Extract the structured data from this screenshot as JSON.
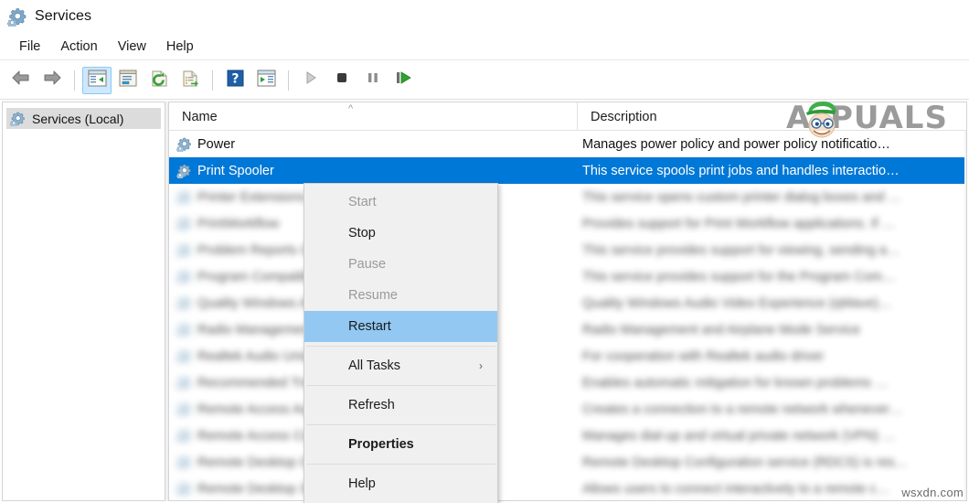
{
  "window": {
    "title": "Services",
    "icon": "services-gear-icon"
  },
  "menubar": {
    "items": [
      {
        "label": "File",
        "name": "menu-file"
      },
      {
        "label": "Action",
        "name": "menu-action"
      },
      {
        "label": "View",
        "name": "menu-view"
      },
      {
        "label": "Help",
        "name": "menu-help"
      }
    ]
  },
  "toolbar": {
    "buttons": [
      {
        "icon": "back-arrow-icon",
        "name": "toolbar-back",
        "active": false
      },
      {
        "icon": "forward-arrow-icon",
        "name": "toolbar-forward",
        "active": false
      },
      {
        "icon": "show-hide-console-tree-icon",
        "name": "toolbar-show-console-tree",
        "active": true
      },
      {
        "icon": "properties-window-icon",
        "name": "toolbar-properties",
        "active": false
      },
      {
        "icon": "refresh-icon",
        "name": "toolbar-refresh",
        "active": false
      },
      {
        "icon": "export-list-icon",
        "name": "toolbar-export-list",
        "active": false
      },
      {
        "icon": "help-icon",
        "name": "toolbar-help",
        "active": false
      },
      {
        "icon": "show-action-pane-icon",
        "name": "toolbar-show-action-pane",
        "active": false
      },
      {
        "icon": "start-service-icon",
        "name": "toolbar-start-service",
        "active": false
      },
      {
        "icon": "stop-service-icon",
        "name": "toolbar-stop-service",
        "active": false
      },
      {
        "icon": "pause-service-icon",
        "name": "toolbar-pause-service",
        "active": false
      },
      {
        "icon": "restart-service-icon",
        "name": "toolbar-restart-service",
        "active": false
      }
    ]
  },
  "tree": {
    "root_label": "Services (Local)"
  },
  "list": {
    "columns": [
      {
        "label": "Name",
        "name": "column-header-name",
        "sort": "ascending"
      },
      {
        "label": "Description",
        "name": "column-header-description"
      }
    ],
    "rows": [
      {
        "name": "Power",
        "description": "Manages power policy and power policy notificatio…",
        "selected": false,
        "blurred": false
      },
      {
        "name": "Print Spooler",
        "description": "This service spools print jobs and handles interactio…",
        "selected": true,
        "blurred": false
      },
      {
        "name": "Printer Extensions and Notifications",
        "description": "This service opens custom printer dialog boxes and …",
        "selected": false,
        "blurred": true
      },
      {
        "name": "PrintWorkflow",
        "description": "Provides support for Print Workflow applications. If …",
        "selected": false,
        "blurred": true
      },
      {
        "name": "Problem Reports Control Panel Support",
        "description": "This service provides support for viewing, sending a…",
        "selected": false,
        "blurred": true
      },
      {
        "name": "Program Compatibility Assistant Service",
        "description": "This service provides support for the Program Com…",
        "selected": false,
        "blurred": true
      },
      {
        "name": "Quality Windows Audio Video Experience",
        "description": "Quality Windows Audio Video Experience (qWave)…",
        "selected": false,
        "blurred": true
      },
      {
        "name": "Radio Management Service",
        "description": "Radio Management and Airplane Mode Service",
        "selected": false,
        "blurred": true
      },
      {
        "name": "Realtek Audio Universal Service",
        "description": "For cooperation with Realtek audio driver",
        "selected": false,
        "blurred": true
      },
      {
        "name": "Recommended Troubleshooting Service",
        "description": "Enables automatic mitigation for known problems …",
        "selected": false,
        "blurred": true
      },
      {
        "name": "Remote Access Auto Connection Manager",
        "description": "Creates a connection to a remote network whenever…",
        "selected": false,
        "blurred": true
      },
      {
        "name": "Remote Access Connection Manager",
        "description": "Manages dial-up and virtual private network (VPN) …",
        "selected": false,
        "blurred": true
      },
      {
        "name": "Remote Desktop Configuration",
        "description": "Remote Desktop Configuration service (RDCS) is res…",
        "selected": false,
        "blurred": true
      },
      {
        "name": "Remote Desktop Services",
        "description": "Allows users to connect interactively to a remote c…",
        "selected": false,
        "blurred": true
      }
    ]
  },
  "context_menu": {
    "items": [
      {
        "label": "Start",
        "name": "context-menu-start",
        "state": "disabled"
      },
      {
        "label": "Stop",
        "name": "context-menu-stop",
        "state": "enabled"
      },
      {
        "label": "Pause",
        "name": "context-menu-pause",
        "state": "disabled"
      },
      {
        "label": "Resume",
        "name": "context-menu-resume",
        "state": "disabled"
      },
      {
        "label": "Restart",
        "name": "context-menu-restart",
        "state": "highlighted"
      },
      {
        "separator": true
      },
      {
        "label": "All Tasks",
        "name": "context-menu-all-tasks",
        "state": "enabled",
        "submenu": true
      },
      {
        "separator": true
      },
      {
        "label": "Refresh",
        "name": "context-menu-refresh",
        "state": "enabled"
      },
      {
        "separator": true
      },
      {
        "label": "Properties",
        "name": "context-menu-properties",
        "state": "bold"
      },
      {
        "separator": true
      },
      {
        "label": "Help",
        "name": "context-menu-help",
        "state": "enabled"
      }
    ]
  },
  "watermarks": {
    "appuals": "PUALS",
    "appuals_prefix": "A",
    "site": "wsxdn.com"
  },
  "colors": {
    "selection_blue": "#0078d7",
    "menu_highlight": "#92c8f2",
    "toolbar_active": "#cde8ff",
    "watermark_gray": "#9b9b9b"
  }
}
